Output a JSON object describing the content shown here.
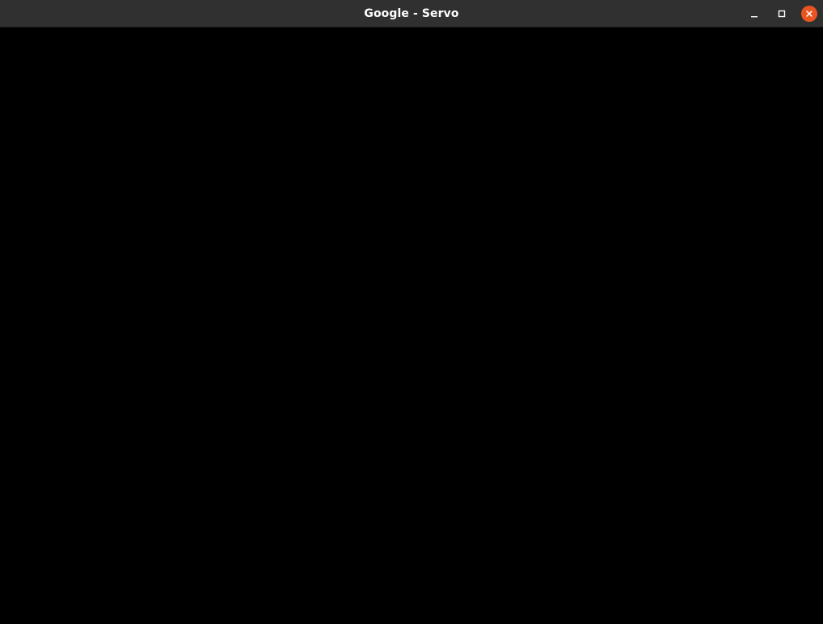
{
  "window": {
    "title": "Google - Servo",
    "controls": {
      "minimize_icon": "minimize-icon",
      "maximize_icon": "maximize-icon",
      "close_icon": "close-icon"
    },
    "colors": {
      "titlebar": "#303030",
      "title_text": "#ffffff",
      "close_accent": "#e95420",
      "content_bg": "#000000"
    }
  }
}
